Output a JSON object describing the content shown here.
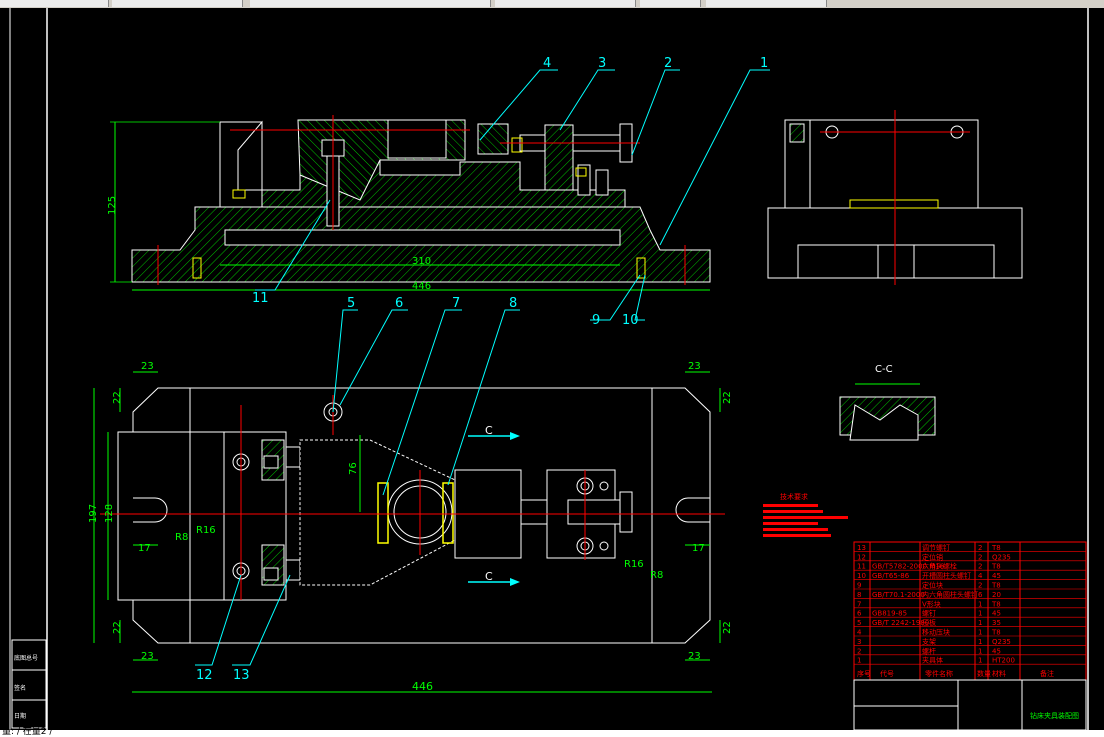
{
  "colors": {
    "background": "#000000",
    "outline": "#ffffff",
    "dimension": "#00ff00",
    "hatch": "#00c000",
    "center": "#ff0000",
    "leader": "#00ffff",
    "highlight": "#ffff00",
    "frame": "#ff0000"
  },
  "cmdline": {
    "text": "量: / 在量2 /"
  },
  "balloons": [
    "1",
    "2",
    "3",
    "4",
    "5",
    "6",
    "7",
    "8",
    "9",
    "10",
    "11",
    "12",
    "13"
  ],
  "dims": {
    "front_width": "446",
    "front_inner": "310",
    "front_height": "125",
    "top_width": "446",
    "top_height": "197",
    "top_inner_height": "128",
    "corner_a": "23",
    "corner_b": "22",
    "hole_dist": "76",
    "slot_w": "17",
    "radius_16": "R16",
    "radius_8": "R8"
  },
  "section": {
    "label": "C",
    "title": "C-C"
  },
  "bom": {
    "rows": [
      {
        "no": "13",
        "code": "",
        "name": "调节螺钉",
        "qty": "2",
        "mat": "T8"
      },
      {
        "no": "12",
        "code": "",
        "name": "定位销",
        "qty": "2",
        "mat": "Q235"
      },
      {
        "no": "11",
        "code": "GB/T5782-2000 M16",
        "name": "六角头螺栓",
        "qty": "2",
        "mat": "T8"
      },
      {
        "no": "10",
        "code": "GB/T65-86",
        "name": "开槽圆柱头螺钉",
        "qty": "4",
        "mat": "45"
      },
      {
        "no": "9",
        "code": "",
        "name": "定位块",
        "qty": "2",
        "mat": "T8"
      },
      {
        "no": "8",
        "code": "GB/T70.1-2000",
        "name": "内六角圆柱头螺钉",
        "qty": "6",
        "mat": "20"
      },
      {
        "no": "7",
        "code": "",
        "name": "V形块",
        "qty": "1",
        "mat": "T8"
      },
      {
        "no": "6",
        "code": "GB819-85",
        "name": "螺钉",
        "qty": "1",
        "mat": "45"
      },
      {
        "no": "5",
        "code": "GB/T 2242-1980",
        "name": "压板",
        "qty": "1",
        "mat": "35"
      },
      {
        "no": "4",
        "code": "",
        "name": "移动压块",
        "qty": "1",
        "mat": "T8"
      },
      {
        "no": "3",
        "code": "",
        "name": "支架",
        "qty": "1",
        "mat": "Q235"
      },
      {
        "no": "2",
        "code": "",
        "name": "螺杆",
        "qty": "1",
        "mat": "45"
      },
      {
        "no": "1",
        "code": "",
        "name": "夹具体",
        "qty": "1",
        "mat": "HT200"
      }
    ],
    "header": [
      "序号",
      "代号",
      "零件名称",
      "数量",
      "材料",
      "备注"
    ],
    "title": "钻床夹具装配图"
  },
  "notes": {
    "title": "技术要求"
  },
  "left_strip": {
    "items": [
      "底图总号",
      "签名",
      "日期"
    ]
  }
}
